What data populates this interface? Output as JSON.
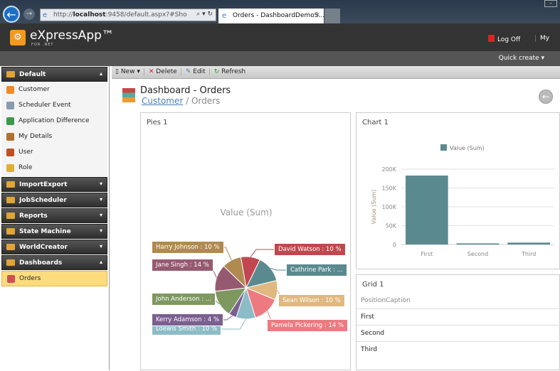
{
  "browser": {
    "url_prefix": "http://",
    "url_host": "localhost",
    "url_rest": ":9458/default.aspx?#Sho",
    "tab_title": "Orders - DashboardDemoS...",
    "close": "×"
  },
  "header": {
    "brand": "eXpressApp™",
    "brand_sub": "FOR .NET",
    "log_off": "Log Off",
    "my": "My",
    "quick_create": "Quick create ▾"
  },
  "sidebar": {
    "groups": [
      {
        "label": "Default",
        "expanded": true,
        "items": [
          {
            "label": "Customer",
            "color": "#f08a24"
          },
          {
            "label": "Scheduler Event",
            "color": "#8a9bb0"
          },
          {
            "label": "Application Difference",
            "color": "#3a9a4a"
          },
          {
            "label": "My Details",
            "color": "#b07030"
          },
          {
            "label": "User",
            "color": "#c05020"
          },
          {
            "label": "Role",
            "color": "#e0b030"
          }
        ]
      },
      {
        "label": "ImportExport"
      },
      {
        "label": "JobScheduler"
      },
      {
        "label": "Reports"
      },
      {
        "label": "State Machine"
      },
      {
        "label": "WorldCreator"
      },
      {
        "label": "Dashboards",
        "expanded": true,
        "items": [
          {
            "label": "Orders",
            "color": "#d05050",
            "selected": true
          }
        ]
      }
    ]
  },
  "toolbar": {
    "new": "New ▾",
    "delete": "Delete",
    "edit": "Edit",
    "refresh": "Refresh"
  },
  "page": {
    "title": "Dashboard - Orders",
    "crumb_link": "Customer",
    "crumb_sep": " / ",
    "crumb_current": "Orders"
  },
  "pies": {
    "title": "Pies 1",
    "caption": "Value (Sum)"
  },
  "chart_data": [
    {
      "type": "pie",
      "title": "Value (Sum)",
      "slices": [
        {
          "label": "David Watson : 10 %",
          "name": "David Watson",
          "value": 10,
          "color": "#c0474f"
        },
        {
          "label": "Cathrine Park : ...",
          "name": "Cathrine Park",
          "value": 14,
          "color": "#5a8a90"
        },
        {
          "label": "Sean Wilson : 10 %",
          "name": "Sean Wilson",
          "value": 10,
          "color": "#e0b880"
        },
        {
          "label": "Pamela Pickering : 14 %",
          "name": "Pamela Pickering",
          "value": 14,
          "color": "#ec7a80"
        },
        {
          "label": "Loewis Smith : 10 %",
          "name": "Loewis Smith",
          "value": 10,
          "color": "#8cbcc6"
        },
        {
          "label": "Kerry Adamson : 4 %",
          "name": "Kerry Adamson",
          "value": 4,
          "color": "#7a6090"
        },
        {
          "label": "John Anderson : ...",
          "name": "John Anderson",
          "value": 14,
          "color": "#7e9860"
        },
        {
          "label": "Jane Singh : 14 %",
          "name": "Jane Singh",
          "value": 14,
          "color": "#965a70"
        },
        {
          "label": "Harry Johnson : 10 %",
          "name": "Harry Johnson",
          "value": 10,
          "color": "#b08a50"
        }
      ]
    },
    {
      "type": "bar",
      "title": "Chart 1",
      "legend": "Value (Sum)",
      "legend_position": "top",
      "ylabel": "Value (Sum)",
      "categories": [
        "First",
        "Second",
        "Third"
      ],
      "values": [
        183000,
        3000,
        5000
      ],
      "ylim": [
        0,
        200000
      ],
      "yticks": [
        "0",
        "50K",
        "100K",
        "150K",
        "200K"
      ],
      "color": "#5a8a90",
      "grid": true
    }
  ],
  "grid": {
    "title": "Grid 1",
    "column": "PositionCaption",
    "rows": [
      "First",
      "Second",
      "Third"
    ]
  }
}
